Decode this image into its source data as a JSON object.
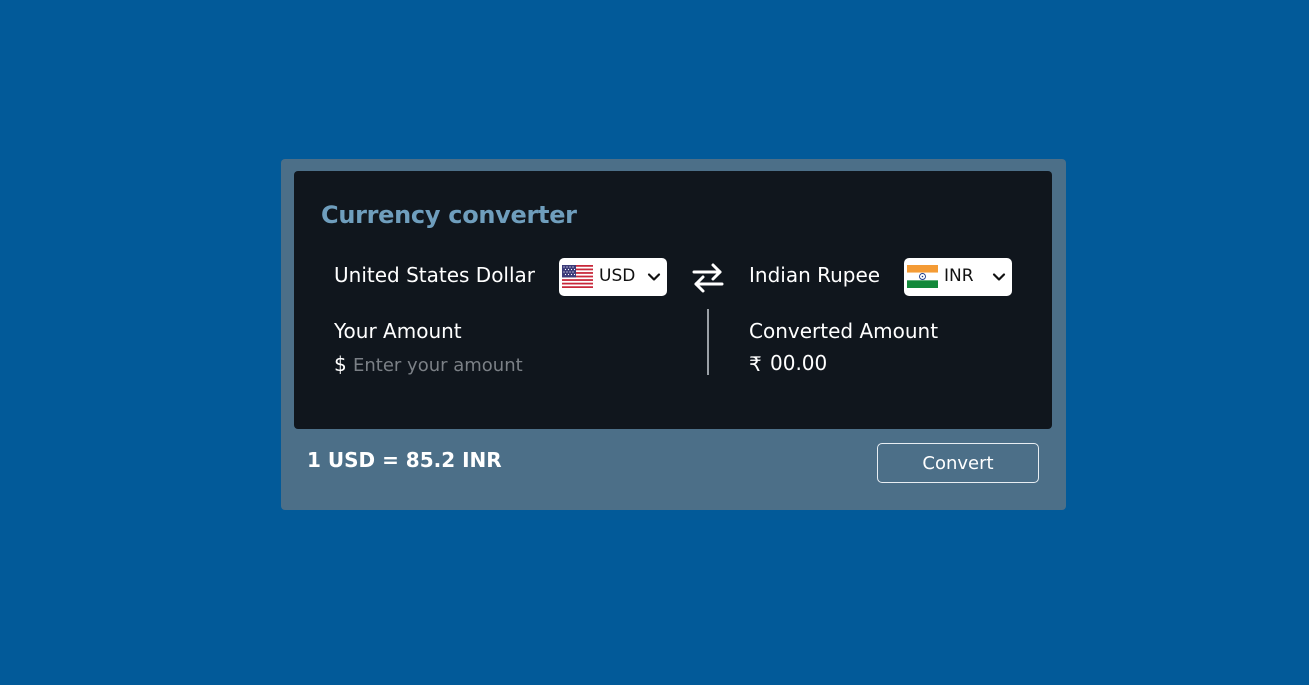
{
  "app": {
    "title": "Currency converter"
  },
  "from": {
    "currency_name": "United States Dollar",
    "code": "USD",
    "flag_icon": "us-flag-icon",
    "amount_label": "Your Amount",
    "symbol": "$",
    "amount_value": "",
    "amount_placeholder": "Enter your amount"
  },
  "to": {
    "currency_name": "Indian Rupee",
    "code": "INR",
    "flag_icon": "india-flag-icon",
    "amount_label": "Converted Amount",
    "symbol": "₹",
    "converted_value": "00.00"
  },
  "rate_text": "1 USD = 85.2 INR",
  "convert_button_label": "Convert",
  "icons": {
    "swap": "swap-arrows-icon",
    "dropdown": "chevron-down-icon"
  },
  "colors": {
    "page_background": "#025a99",
    "card_background": "#4c6f88",
    "panel_background": "#10161d",
    "title_color": "#6f9ebd",
    "text_color": "#ffffff",
    "placeholder_color": "#7b8086"
  }
}
